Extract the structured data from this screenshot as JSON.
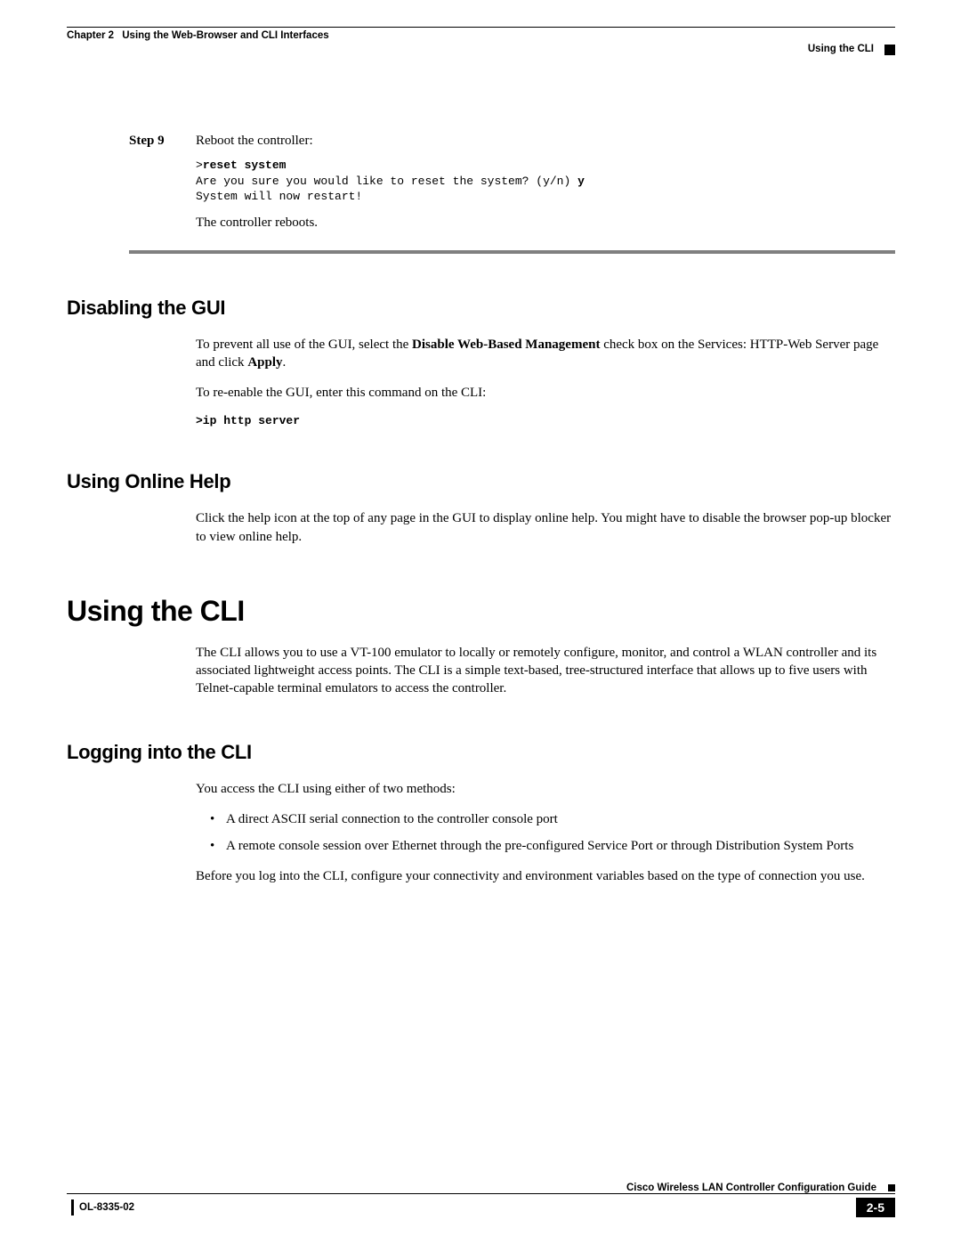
{
  "header": {
    "chapter_label": "Chapter 2",
    "chapter_title": "Using the Web-Browser and CLI Interfaces",
    "section_right": "Using the CLI"
  },
  "step9": {
    "label": "Step 9",
    "intro": "Reboot the controller:",
    "cli_prompt": ">",
    "cli_cmd": "reset system",
    "cli_out_line1": "Are you sure you would like to reset the system? (y/n) ",
    "cli_y": "y",
    "cli_out_line2": "System will now restart!",
    "after": "The controller reboots."
  },
  "disabling_gui": {
    "heading": "Disabling the GUI",
    "para1_a": "To prevent all use of the GUI, select the ",
    "para1_b_bold": "Disable Web-Based Management",
    "para1_c": " check box on the Services: HTTP-Web Server page and click ",
    "para1_d_bold": "Apply",
    "para1_e": ".",
    "para2": "To re-enable the GUI, enter this command on the CLI:",
    "cli": ">ip http server"
  },
  "online_help": {
    "heading": "Using Online Help",
    "para": "Click the help icon at the top of any page in the GUI to display online help. You might have to disable the browser pop-up blocker to view online help."
  },
  "using_cli": {
    "heading": "Using the CLI",
    "para": "The CLI allows you to use a VT-100 emulator to locally or remotely configure, monitor, and control a WLAN controller and its associated lightweight access points. The CLI is a simple text-based, tree-structured interface that allows up to five users with Telnet-capable terminal emulators to access the controller."
  },
  "logging_cli": {
    "heading": "Logging into the CLI",
    "intro": "You access the CLI using either of two methods:",
    "bullets": [
      "A direct ASCII serial connection to the controller console port",
      "A remote console session over Ethernet through the pre-configured Service Port or through Distribution System Ports"
    ],
    "after": "Before you log into the CLI, configure your connectivity and environment variables based on the type of connection you use."
  },
  "footer": {
    "guide_title": "Cisco Wireless LAN Controller Configuration Guide",
    "doc_id": "OL-8335-02",
    "page_num": "2-5"
  }
}
